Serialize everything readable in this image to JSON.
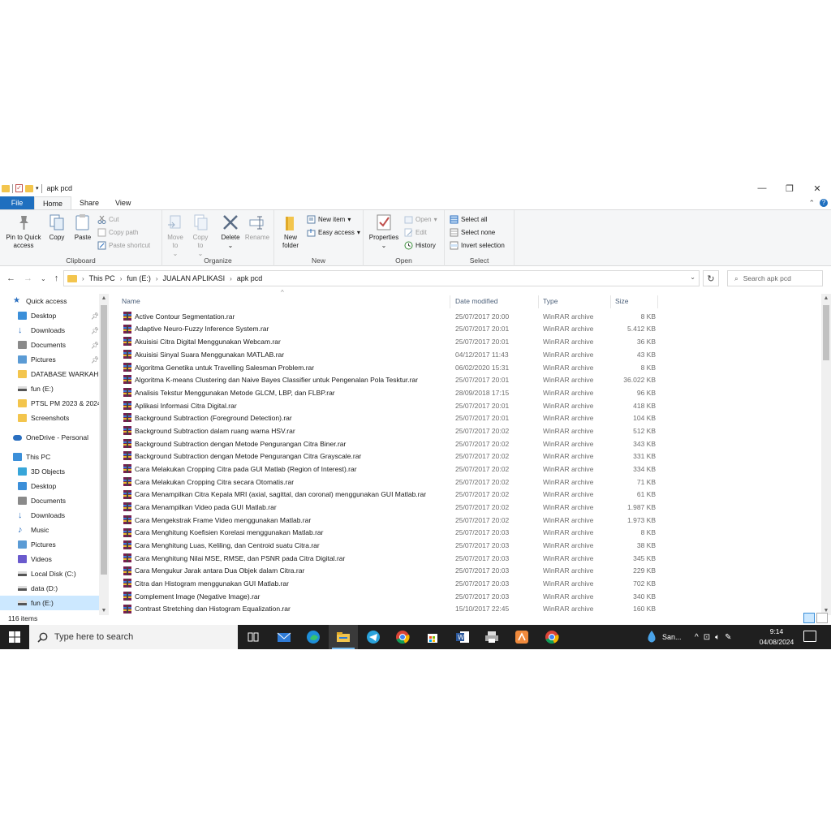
{
  "window": {
    "title": "apk pcd",
    "controls": {
      "minimize": "—",
      "maximize": "❐",
      "close": "✕"
    }
  },
  "tabs": [
    {
      "label": "File"
    },
    {
      "label": "Home"
    },
    {
      "label": "Share"
    },
    {
      "label": "View"
    }
  ],
  "ribbon": {
    "clipboard": {
      "label": "Clipboard",
      "pin": "Pin to Quick access",
      "copy": "Copy",
      "paste": "Paste",
      "cut": "Cut",
      "copy_path": "Copy path",
      "paste_shortcut": "Paste shortcut"
    },
    "organize": {
      "label": "Organize",
      "move_to": "Move to",
      "copy_to": "Copy to",
      "delete": "Delete",
      "rename": "Rename"
    },
    "new": {
      "label": "New",
      "new_folder": "New folder",
      "new_item": "New item",
      "easy_access": "Easy access"
    },
    "open": {
      "label": "Open",
      "properties": "Properties",
      "open": "Open",
      "edit": "Edit",
      "history": "History"
    },
    "select": {
      "label": "Select",
      "select_all": "Select all",
      "select_none": "Select none",
      "invert": "Invert selection"
    }
  },
  "address": {
    "crumbs": [
      "This PC",
      "fun (E:)",
      "JUALAN APLIKASI",
      "apk pcd"
    ],
    "search_placeholder": "Search apk pcd"
  },
  "nav_pane": [
    {
      "label": "Quick access",
      "icon": "star-icon"
    },
    {
      "label": "Desktop",
      "icon": "desktop-icon",
      "pinned": true
    },
    {
      "label": "Downloads",
      "icon": "download-icon",
      "pinned": true
    },
    {
      "label": "Documents",
      "icon": "document-icon",
      "pinned": true
    },
    {
      "label": "Pictures",
      "icon": "pictures-icon",
      "pinned": true
    },
    {
      "label": "DATABASE WARKAH",
      "icon": "folder-icon"
    },
    {
      "label": "fun (E:)",
      "icon": "drive-icon"
    },
    {
      "label": "PTSL PM 2023 & 2024",
      "icon": "folder-icon"
    },
    {
      "label": "Screenshots",
      "icon": "folder-icon"
    },
    {
      "label": "OneDrive - Personal",
      "icon": "cloud-icon"
    },
    {
      "label": "This PC",
      "icon": "pc-icon"
    },
    {
      "label": "3D Objects",
      "icon": "cube-icon"
    },
    {
      "label": "Desktop",
      "icon": "desktop-icon"
    },
    {
      "label": "Documents",
      "icon": "document-icon"
    },
    {
      "label": "Downloads",
      "icon": "download-icon"
    },
    {
      "label": "Music",
      "icon": "music-icon"
    },
    {
      "label": "Pictures",
      "icon": "pictures-icon"
    },
    {
      "label": "Videos",
      "icon": "video-icon"
    },
    {
      "label": "Local Disk (C:)",
      "icon": "drive-icon"
    },
    {
      "label": "data (D:)",
      "icon": "drive-icon"
    },
    {
      "label": "fun (E:)",
      "icon": "drive-icon",
      "selected": true
    }
  ],
  "columns": {
    "name": "Name",
    "date": "Date modified",
    "type": "Type",
    "size": "Size"
  },
  "files": [
    {
      "name": "Active Contour Segmentation.rar",
      "date": "25/07/2017 20:00",
      "type": "WinRAR archive",
      "size": "8 KB"
    },
    {
      "name": "Adaptive Neuro-Fuzzy Inference System.rar",
      "date": "25/07/2017 20:01",
      "type": "WinRAR archive",
      "size": "5.412 KB"
    },
    {
      "name": "Akuisisi Citra Digital Menggunakan Webcam.rar",
      "date": "25/07/2017 20:01",
      "type": "WinRAR archive",
      "size": "36 KB"
    },
    {
      "name": "Akuisisi Sinyal Suara Menggunakan MATLAB.rar",
      "date": "04/12/2017 11:43",
      "type": "WinRAR archive",
      "size": "43 KB"
    },
    {
      "name": "Algoritma Genetika untuk Travelling Salesman Problem.rar",
      "date": "06/02/2020 15:31",
      "type": "WinRAR archive",
      "size": "8 KB"
    },
    {
      "name": "Algoritma K-means Clustering dan Naive Bayes Classifier untuk Pengenalan Pola Tesktur.rar",
      "date": "25/07/2017 20:01",
      "type": "WinRAR archive",
      "size": "36.022 KB"
    },
    {
      "name": "Analisis Tekstur Menggunakan Metode GLCM, LBP, dan FLBP.rar",
      "date": "28/09/2018 17:15",
      "type": "WinRAR archive",
      "size": "96 KB"
    },
    {
      "name": "Aplikasi Informasi Citra Digital.rar",
      "date": "25/07/2017 20:01",
      "type": "WinRAR archive",
      "size": "418 KB"
    },
    {
      "name": "Background Subtraction (Foreground Detection).rar",
      "date": "25/07/2017 20:01",
      "type": "WinRAR archive",
      "size": "104 KB"
    },
    {
      "name": "Background Subtraction dalam ruang warna HSV.rar",
      "date": "25/07/2017 20:02",
      "type": "WinRAR archive",
      "size": "512 KB"
    },
    {
      "name": "Background Subtraction dengan Metode Pengurangan Citra Biner.rar",
      "date": "25/07/2017 20:02",
      "type": "WinRAR archive",
      "size": "343 KB"
    },
    {
      "name": "Background Subtraction dengan Metode Pengurangan Citra Grayscale.rar",
      "date": "25/07/2017 20:02",
      "type": "WinRAR archive",
      "size": "331 KB"
    },
    {
      "name": "Cara Melakukan Cropping Citra pada GUI Matlab (Region of Interest).rar",
      "date": "25/07/2017 20:02",
      "type": "WinRAR archive",
      "size": "334 KB"
    },
    {
      "name": "Cara Melakukan Cropping Citra secara Otomatis.rar",
      "date": "25/07/2017 20:02",
      "type": "WinRAR archive",
      "size": "71 KB"
    },
    {
      "name": "Cara Menampilkan Citra Kepala MRI (axial, sagittal, dan coronal) menggunakan GUI Matlab.rar",
      "date": "25/07/2017 20:02",
      "type": "WinRAR archive",
      "size": "61 KB"
    },
    {
      "name": "Cara Menampilkan Video pada GUI Matlab.rar",
      "date": "25/07/2017 20:02",
      "type": "WinRAR archive",
      "size": "1.987 KB"
    },
    {
      "name": "Cara Mengekstrak Frame Video menggunakan Matlab.rar",
      "date": "25/07/2017 20:02",
      "type": "WinRAR archive",
      "size": "1.973 KB"
    },
    {
      "name": "Cara Menghitung Koefisien Korelasi menggunakan Matlab.rar",
      "date": "25/07/2017 20:03",
      "type": "WinRAR archive",
      "size": "8 KB"
    },
    {
      "name": "Cara Menghitung Luas, Keliling, dan Centroid suatu Citra.rar",
      "date": "25/07/2017 20:03",
      "type": "WinRAR archive",
      "size": "38 KB"
    },
    {
      "name": "Cara Menghitung Nilai MSE, RMSE, dan PSNR pada Citra Digital.rar",
      "date": "25/07/2017 20:03",
      "type": "WinRAR archive",
      "size": "345 KB"
    },
    {
      "name": "Cara Mengukur Jarak antara Dua Objek dalam Citra.rar",
      "date": "25/07/2017 20:03",
      "type": "WinRAR archive",
      "size": "229 KB"
    },
    {
      "name": "Citra dan Histogram menggunakan GUI Matlab.rar",
      "date": "25/07/2017 20:03",
      "type": "WinRAR archive",
      "size": "702 KB"
    },
    {
      "name": "Complement Image (Negative Image).rar",
      "date": "25/07/2017 20:03",
      "type": "WinRAR archive",
      "size": "340 KB"
    },
    {
      "name": "Contrast Stretching dan Histogram Equalization.rar",
      "date": "15/10/2017 22:45",
      "type": "WinRAR archive",
      "size": "160 KB"
    }
  ],
  "status": {
    "items": "116 items"
  },
  "taskbar": {
    "search_placeholder": "Type here to search",
    "weather": "San...",
    "time": "9:14",
    "date": "04/08/2024"
  },
  "colors": {
    "accent": "#1f6fbf",
    "taskbar": "#1f1f1f",
    "folder": "#f3c54d"
  }
}
